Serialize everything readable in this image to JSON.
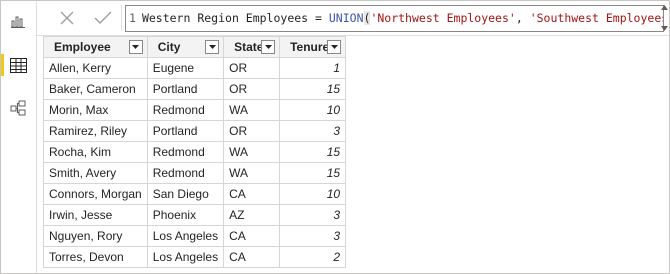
{
  "formula": {
    "line_number": "1",
    "prefix": "Western Region Employees = ",
    "function": "UNION",
    "open_paren": "(",
    "arg1": "'Northwest Employees'",
    "sep": ", ",
    "arg2": "'Southwest Employees'",
    "close_paren": ")"
  },
  "columns": [
    "Employee",
    "City",
    "State",
    "Tenure"
  ],
  "rows": [
    {
      "employee": "Allen, Kerry",
      "city": "Eugene",
      "state": "OR",
      "tenure": "1"
    },
    {
      "employee": "Baker, Cameron",
      "city": "Portland",
      "state": "OR",
      "tenure": "15"
    },
    {
      "employee": "Morin, Max",
      "city": "Redmond",
      "state": "WA",
      "tenure": "10"
    },
    {
      "employee": "Ramirez, Riley",
      "city": "Portland",
      "state": "OR",
      "tenure": "3"
    },
    {
      "employee": "Rocha, Kim",
      "city": "Redmond",
      "state": "WA",
      "tenure": "15"
    },
    {
      "employee": "Smith, Avery",
      "city": "Redmond",
      "state": "WA",
      "tenure": "15"
    },
    {
      "employee": "Connors, Morgan",
      "city": "San Diego",
      "state": "CA",
      "tenure": "10"
    },
    {
      "employee": "Irwin, Jesse",
      "city": "Phoenix",
      "state": "AZ",
      "tenure": "3"
    },
    {
      "employee": "Nguyen, Rory",
      "city": "Los Angeles",
      "state": "CA",
      "tenure": "3"
    },
    {
      "employee": "Torres, Devon",
      "city": "Los Angeles",
      "state": "CA",
      "tenure": "2"
    }
  ],
  "icons": {
    "rail": [
      "report-view-icon",
      "data-view-icon",
      "model-view-icon"
    ],
    "formula_buttons": [
      "cancel-icon",
      "commit-icon"
    ]
  },
  "colors": {
    "active_view_marker": "#f2c811",
    "keyword": "#3e55a4",
    "string": "#a31515"
  }
}
